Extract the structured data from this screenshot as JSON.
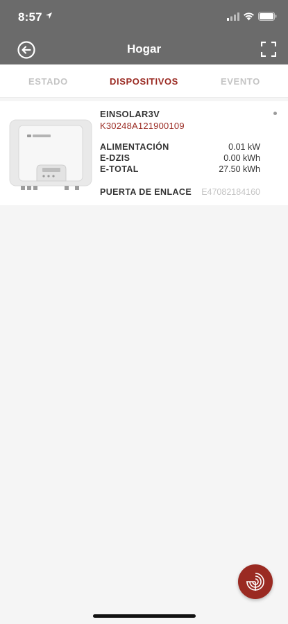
{
  "status_bar": {
    "time": "8:57",
    "icons": [
      "location-arrow-icon",
      "cellular-signal-icon",
      "wifi-icon",
      "battery-icon"
    ]
  },
  "header": {
    "title": "Hogar",
    "back_icon": "back-arrow-circle-icon",
    "fullscreen_icon": "fullscreen-icon"
  },
  "tabs": [
    {
      "label": "ESTADO",
      "active": false
    },
    {
      "label": "DISPOSITIVOS",
      "active": true
    },
    {
      "label": "EVENTO",
      "active": false
    }
  ],
  "device": {
    "name": "EINSOLAR3V",
    "serial": "K30248A121900109",
    "metrics": [
      {
        "label": "ALIMENTACIÓN",
        "value": "0.01 kW"
      },
      {
        "label": "E-DZIS",
        "value": "0.00 kWh"
      },
      {
        "label": "E-TOTAL",
        "value": "27.50 kWh"
      }
    ],
    "gateway_label": "PUERTA DE ENLACE",
    "gateway_value": "E47082184160"
  },
  "colors": {
    "header_bg": "#6b6b6b",
    "accent": "#9a2a22",
    "inactive_tab": "#c4c4c4"
  }
}
